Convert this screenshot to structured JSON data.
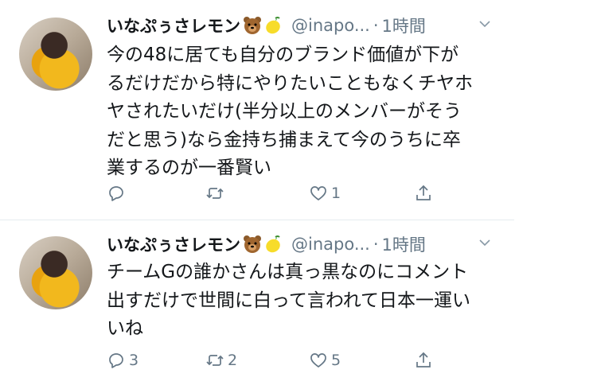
{
  "tweets": [
    {
      "display_name": "いなぷぅさレモン",
      "emoji": [
        "bear-icon",
        "lemon-icon"
      ],
      "handle": "@inapo...",
      "dot": "·",
      "time": "1時間",
      "text": "今の48に居ても自分のブランド価値が下が\nるだけだから特にやりたいこともなくチヤホ\nヤされたいだけ(半分以上のメンバーがそう\nだと思う)なら金持ち捕まえて今のうちに卒\n業するのが一番賢い",
      "reply_count": "",
      "retweet_count": "",
      "like_count": "1"
    },
    {
      "display_name": "いなぷぅさレモン",
      "emoji": [
        "bear-icon",
        "lemon-icon"
      ],
      "handle": "@inapo...",
      "dot": "·",
      "time": "1時間",
      "text": "チームGの誰かさんは真っ黒なのにコメント\n出すだけで世間に白って言われて日本一運い\nいね",
      "reply_count": "3",
      "retweet_count": "2",
      "like_count": "5"
    }
  ],
  "colors": {
    "text": "#14171a",
    "secondary": "#657786",
    "divider": "#e6ecf0"
  }
}
